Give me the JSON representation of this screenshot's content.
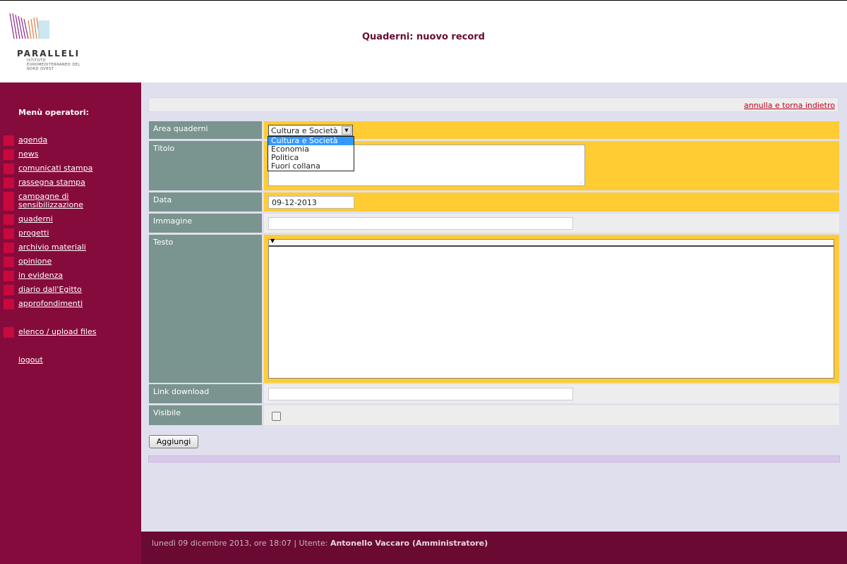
{
  "header": {
    "logo_text": "PARALLELI",
    "logo_sub": "ISTITUTO EUROMEDITERRANEO DEL NORD OVEST",
    "page_title": "Quaderni: nuovo record"
  },
  "sidebar": {
    "title": "Menù operatori:",
    "items": [
      {
        "label": "agenda"
      },
      {
        "label": "news"
      },
      {
        "label": "comunicati stampa"
      },
      {
        "label": "rassegna stampa"
      },
      {
        "label": "campagne di sensibilizzazione"
      },
      {
        "label": "quaderni"
      },
      {
        "label": "progetti"
      },
      {
        "label": "archivio materiali"
      },
      {
        "label": "opinione"
      },
      {
        "label": "in evidenza"
      },
      {
        "label": "diario dall'Egitto"
      },
      {
        "label": "approfondimenti"
      }
    ],
    "upload_label": "elenco / upload files",
    "logout_label": "logout"
  },
  "topbar": {
    "cancel_label": "annulla e torna indietro"
  },
  "form": {
    "area": {
      "label": "Area quaderni",
      "selected": "Cultura e Società",
      "options": [
        "Cultura e Società",
        "Economia",
        "Politica",
        "Fuori collana"
      ]
    },
    "titolo": {
      "label": "Titolo",
      "value": ""
    },
    "data": {
      "label": "Data",
      "value": "09-12-2013"
    },
    "immagine": {
      "label": "Immagine",
      "value": ""
    },
    "testo": {
      "label": "Testo",
      "value": ""
    },
    "link": {
      "label": "Link download",
      "value": ""
    },
    "visibile": {
      "label": "Visibile",
      "checked": false
    },
    "submit_label": "Aggiungi"
  },
  "footer": {
    "date_text": "lunedì 09 dicembre 2013, ore 18:07 | Utente: ",
    "user": "Antonello Vaccaro (Amministratore)"
  },
  "colors": {
    "sidebar": "#850b3c",
    "accent_square": "#c8093e",
    "label_bg": "#7a9490",
    "required_bg": "#ffcc33",
    "title_color": "#6b0a33"
  }
}
